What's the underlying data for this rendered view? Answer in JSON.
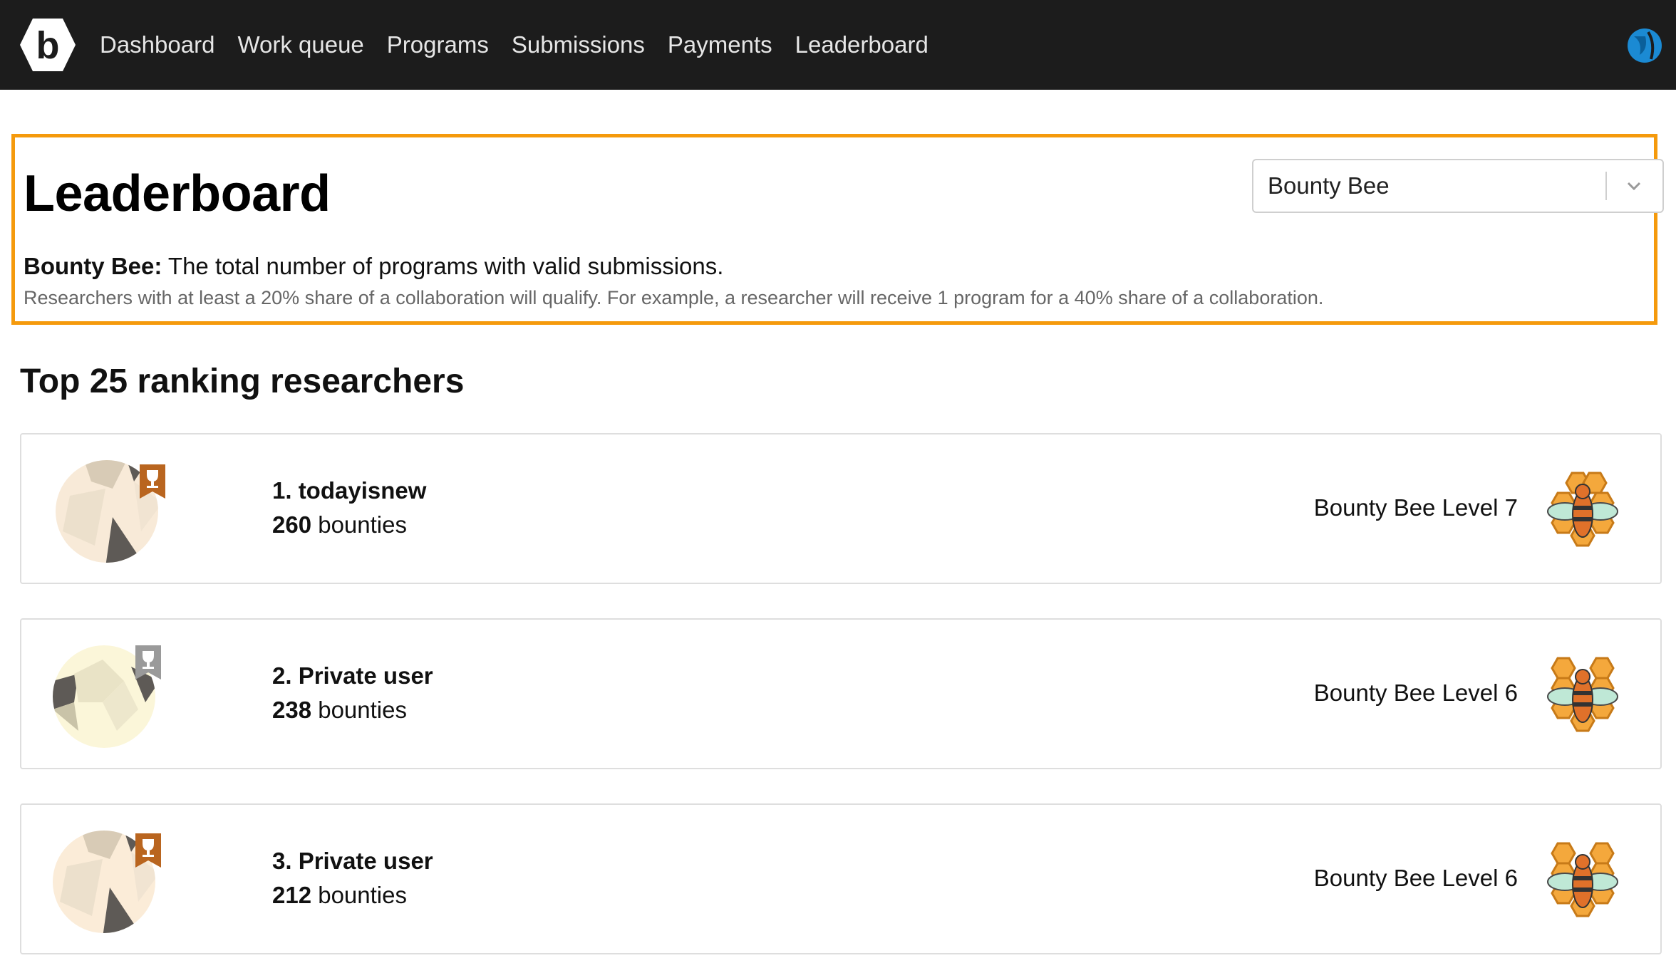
{
  "nav": {
    "logo_letter": "b",
    "links": [
      "Dashboard",
      "Work queue",
      "Programs",
      "Submissions",
      "Payments",
      "Leaderboard"
    ],
    "accent_color": "#1b8ad3"
  },
  "header": {
    "title": "Leaderboard",
    "metric_select": {
      "selected": "Bounty Bee"
    },
    "description_bold": "Bounty Bee:",
    "description_text": " The total number of programs with valid submissions.",
    "note": "Researchers with at least a 20% share of a collaboration will qualify. For example, a researcher will receive 1 program for a 40% share of a collaboration.",
    "highlight_color": "#f59a0c"
  },
  "ranking": {
    "section_title": "Top 25 ranking researchers",
    "researchers": [
      {
        "rank_name": "1. todayisnew",
        "bounty_count": "260",
        "bounty_unit": " bounties",
        "level": "Bounty Bee Level 7",
        "trophy": "bronze-trophy-icon"
      },
      {
        "rank_name": "2. Private user",
        "bounty_count": "238",
        "bounty_unit": " bounties",
        "level": "Bounty Bee Level 6",
        "trophy": "silver-trophy-icon"
      },
      {
        "rank_name": "3. Private user",
        "bounty_count": "212",
        "bounty_unit": " bounties",
        "level": "Bounty Bee Level 6",
        "trophy": "bronze-trophy-icon"
      }
    ]
  }
}
